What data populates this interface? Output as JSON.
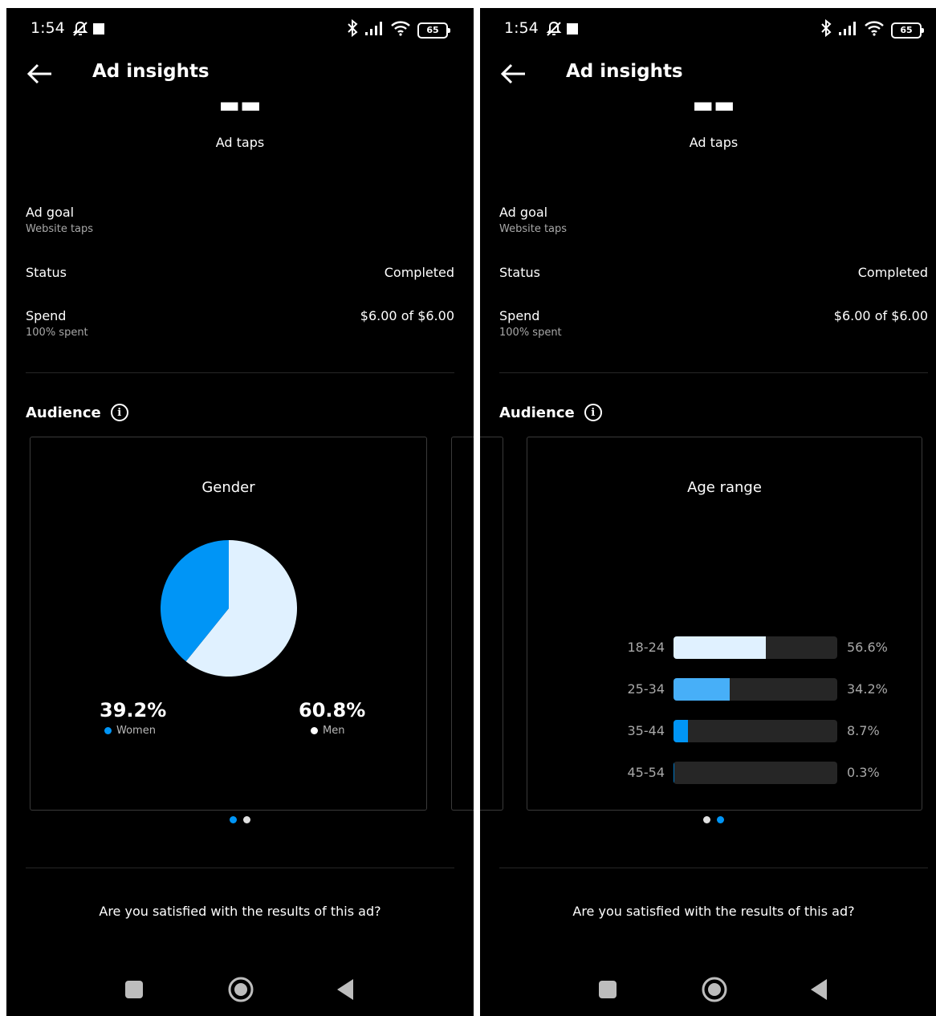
{
  "status_bar": {
    "time": "1:54",
    "battery": "65"
  },
  "header": {
    "title": "Ad insights"
  },
  "metric": {
    "label": "Ad taps"
  },
  "ad_goal": {
    "label": "Ad goal",
    "value": "Website taps"
  },
  "status": {
    "label": "Status",
    "value": "Completed"
  },
  "spend": {
    "label": "Spend",
    "sub": "100% spent",
    "value": "$6.00 of $6.00"
  },
  "audience": {
    "title": "Audience"
  },
  "gender_card": {
    "title": "Gender",
    "women": {
      "pct": "39.2%",
      "label": "Women",
      "color": "#0095f6"
    },
    "men": {
      "pct": "60.8%",
      "label": "Men",
      "color": "#e0f1ff"
    }
  },
  "age_card": {
    "title": "Age range",
    "rows": [
      {
        "range": "18-24",
        "pct": "56.6%",
        "color": "#e0f1ff"
      },
      {
        "range": "25-34",
        "pct": "34.2%",
        "color": "#47aff8"
      },
      {
        "range": "35-44",
        "pct": "8.7%",
        "color": "#0095f6"
      },
      {
        "range": "45-54",
        "pct": "0.3%",
        "color": "#0077c2"
      }
    ]
  },
  "question": "Are you satisfied with the results of this ad?",
  "chart_data": [
    {
      "type": "pie",
      "title": "Gender",
      "categories": [
        "Women",
        "Men"
      ],
      "values": [
        39.2,
        60.8
      ]
    },
    {
      "type": "bar",
      "title": "Age range",
      "categories": [
        "18-24",
        "25-34",
        "35-44",
        "45-54"
      ],
      "values": [
        56.6,
        34.2,
        8.7,
        0.3
      ]
    }
  ]
}
